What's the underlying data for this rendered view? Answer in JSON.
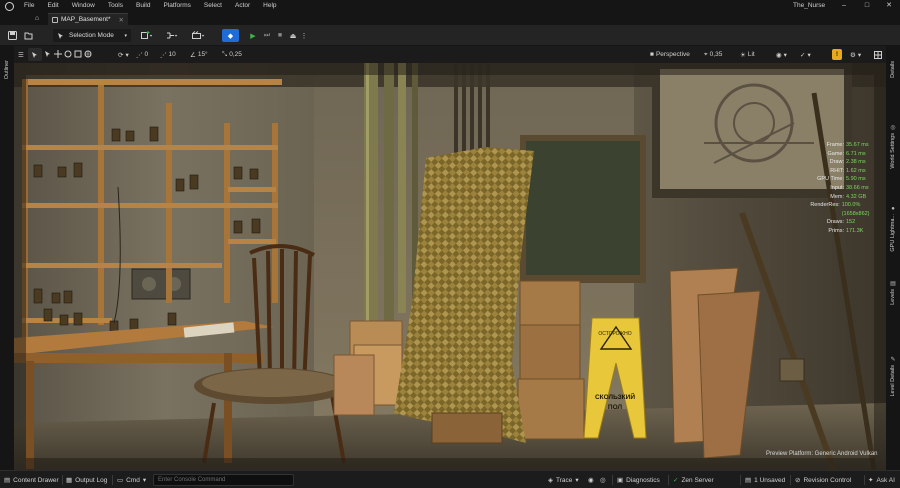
{
  "menu": {
    "items": [
      "File",
      "Edit",
      "Window",
      "Tools",
      "Build",
      "Platforms",
      "Select",
      "Actor",
      "Help"
    ],
    "project_name": "The_Nurse",
    "minimize": "–",
    "maximize": "□",
    "close": "✕"
  },
  "tabs": {
    "home_icon": "⌂",
    "map_tab": "MAP_Basement*",
    "close_glyph": "✕"
  },
  "toolbar": {
    "save_icon": "💾",
    "selection_mode": "Selection Mode",
    "play_glyph": "▶",
    "step_glyph": "⏭",
    "stop_glyph": "■",
    "eject_glyph": "⏏",
    "more_glyph": "⋮",
    "platform_glyph": "◆",
    "chevron": "▾"
  },
  "viewport_toolbar": {
    "menu_glyph": "☰",
    "snap_angle_value": "10",
    "rotation_snap": "15°",
    "grid_value": "0",
    "scale_snap": "0,25",
    "view_mode": "Perspective",
    "fov_value": "0,35",
    "lit_mode": "Lit",
    "show_glyph": "👁",
    "perf_badge": "!",
    "settings_glyph": "⚙"
  },
  "stats": {
    "rows": [
      {
        "label": "Frame:",
        "value": "35.67 ms"
      },
      {
        "label": "Game:",
        "value": "6.71 ms"
      },
      {
        "label": "Draw:",
        "value": "2.38 ms"
      },
      {
        "label": "RHIT:",
        "value": "1.62 ms"
      },
      {
        "label": "GPU Time:",
        "value": "5.90 ms"
      },
      {
        "label": "Input:",
        "value": "38.66 ms"
      },
      {
        "label": "Mem:",
        "value": "4.32 GB"
      },
      {
        "label": "RenderRes:",
        "value": "100.0% (1658x862)"
      },
      {
        "label": "Draws:",
        "value": "152"
      },
      {
        "label": "Prims:",
        "value": "171.3K"
      }
    ]
  },
  "preview_platform": "Preview Platform:  Generic Android Vulkan",
  "wet_floor_sign": {
    "top": "OСТОРОЖНО",
    "line1": "СКОЛЬЗКИЙ",
    "line2": "ПОЛ"
  },
  "left_panel": {
    "outliner": "Outliner"
  },
  "right_panels": [
    "Details",
    "World Settings",
    "GPU Lightma...",
    "Levels",
    "Level Details"
  ],
  "statusbar": {
    "content_drawer": "Content Drawer",
    "output_log": "Output Log",
    "cmd": "Cmd",
    "console_placeholder": "Enter Console Command",
    "trace": "Trace",
    "diagnostics": "Diagnostics",
    "zen_server": "Zen Server",
    "unsaved": "1 Unsaved",
    "revision_control": "Revision Control",
    "ask_ai": "Ask AI"
  },
  "colors": {
    "accent_blue": "#1f6bd8",
    "play_green": "#3fb44a",
    "stat_green": "#7cd95c",
    "warning_yellow": "#e8a820"
  }
}
